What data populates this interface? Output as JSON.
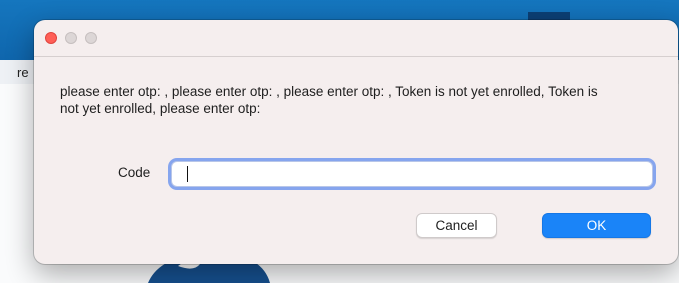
{
  "background_app": {
    "subbar_text": "re"
  },
  "dialog": {
    "message": "please enter otp: , please enter otp: , please enter otp: , Token is not yet enrolled, Token is not yet enrolled, please enter otp:",
    "code_label": "Code",
    "code_value": "",
    "cancel_label": "Cancel",
    "ok_label": "OK",
    "window_controls": [
      "close-icon",
      "minimize-icon",
      "zoom-icon"
    ]
  },
  "colors": {
    "top_bar": "#1576be",
    "close_button": "#ff5f57",
    "primary_button": "#1a84f8",
    "focus_ring": "#608cee",
    "dialog_background": "#f5eeee"
  }
}
